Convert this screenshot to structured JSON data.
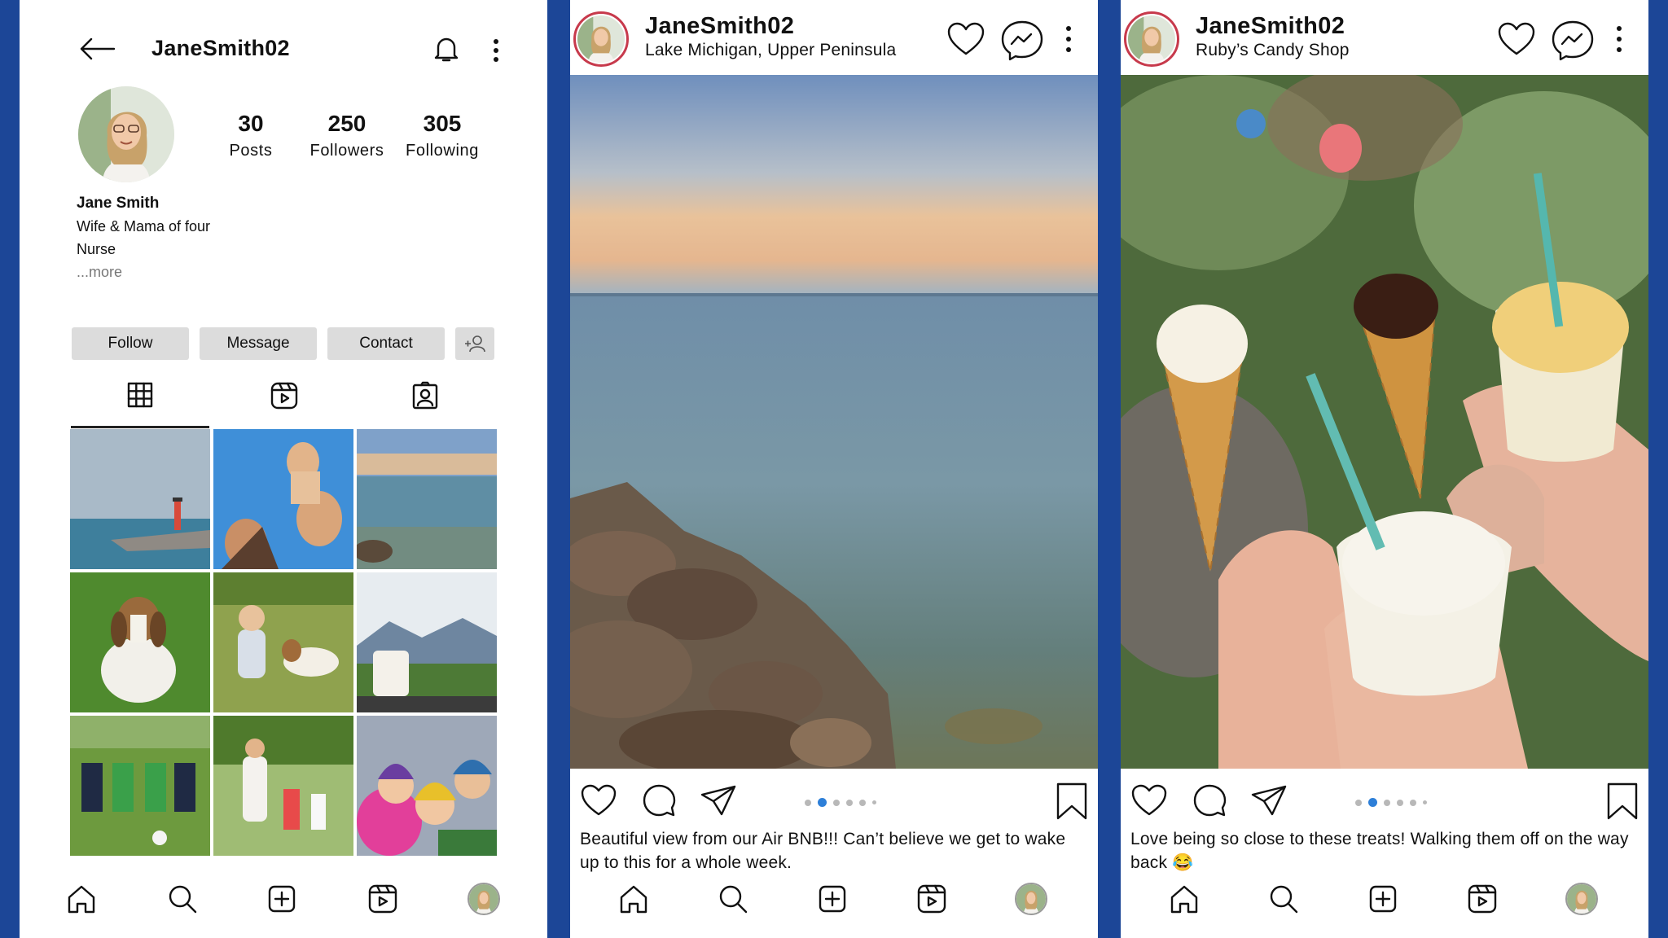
{
  "profile": {
    "username": "JaneSmith02",
    "stats": [
      {
        "value": "30",
        "label": "Posts"
      },
      {
        "value": "250",
        "label": "Followers"
      },
      {
        "value": "305",
        "label": "Following"
      }
    ],
    "bio": {
      "name": "Jane Smith",
      "lines": [
        "Wife & Mama of four",
        "Nurse"
      ],
      "more": "...more"
    },
    "buttons": {
      "follow": "Follow",
      "message": "Message",
      "contact": "Contact"
    },
    "tabs": [
      "grid-icon",
      "reels-icon",
      "tagged-icon"
    ],
    "grid": [
      "lighthouse",
      "dad-and-kids",
      "lake-sunset",
      "beagle",
      "toddler-with-beagle",
      "coffee-mountains",
      "kids-soccer",
      "mom-running-with-kids",
      "kids-in-winter-hats"
    ]
  },
  "posts": [
    {
      "username": "JaneSmith02",
      "location": "Lake Michigan, Upper Peninsula",
      "image": "lake-sunset-rocks",
      "caption": "Beautiful view from our Air BNB!!! Can’t believe we get to wake up to this for a whole week."
    },
    {
      "username": "JaneSmith02",
      "location": "Ruby’s Candy Shop",
      "image": "ice-cream-cones",
      "caption": "Love being so close to these treats! Walking them off on the way back 😂"
    }
  ],
  "carousel": {
    "count": 6,
    "active_index": 1
  },
  "nav": [
    "home-icon",
    "search-icon",
    "create-icon",
    "reels-icon",
    "profile-avatar"
  ],
  "colors": {
    "background": "#1c4697",
    "button": "#dcdcdc",
    "active_dot": "#2d7fd8",
    "story_ring": "#c73a4c"
  }
}
